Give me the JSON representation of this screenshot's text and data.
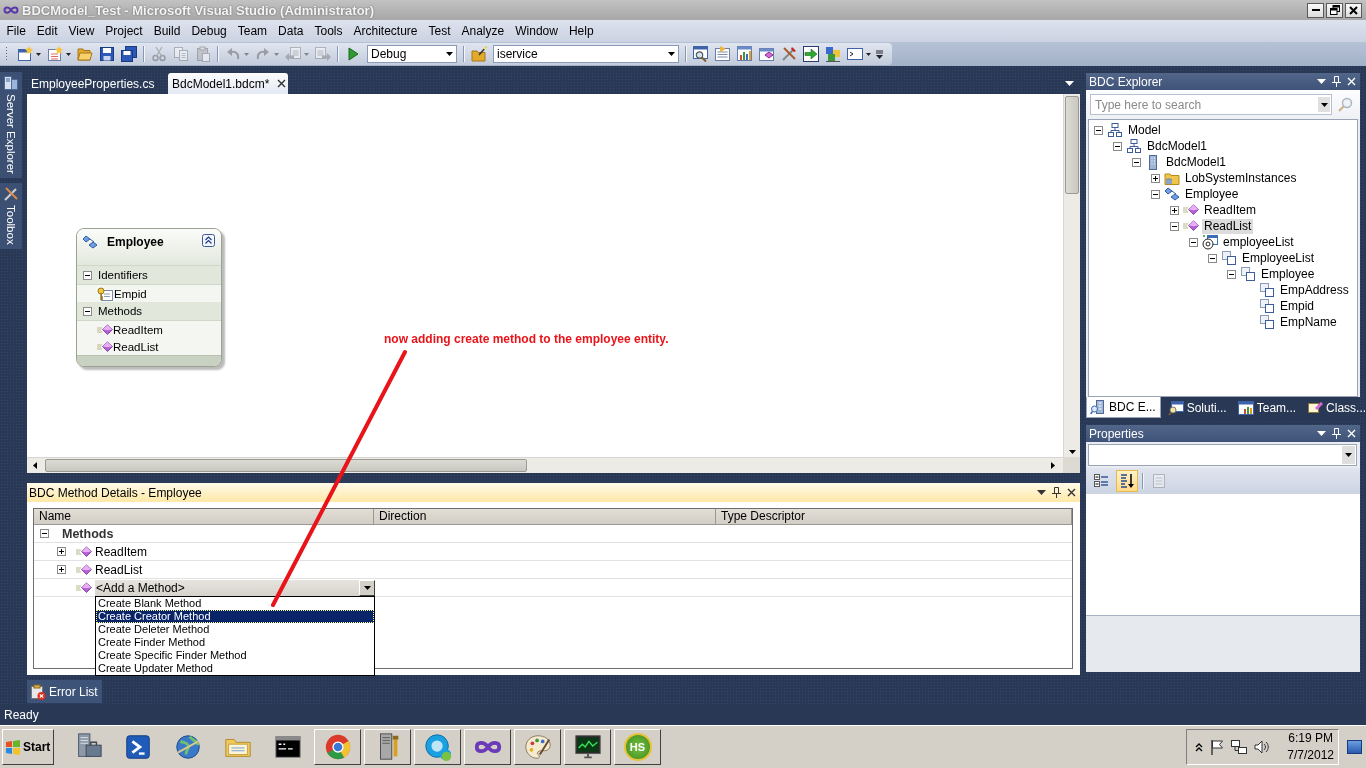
{
  "window": {
    "title": "BDCModel_Test - Microsoft Visual Studio (Administrator)"
  },
  "menu": [
    "File",
    "Edit",
    "View",
    "Project",
    "Build",
    "Debug",
    "Team",
    "Data",
    "Tools",
    "Architecture",
    "Test",
    "Analyze",
    "Window",
    "Help"
  ],
  "toolbar": [
    {
      "kind": "new-project",
      "disabled": false
    },
    {
      "kind": "add-item",
      "disabled": false
    },
    {
      "kind": "open",
      "disabled": false
    },
    {
      "kind": "save",
      "disabled": false
    },
    {
      "kind": "save-all",
      "disabled": false
    },
    {
      "kind": "separator"
    },
    {
      "kind": "cut",
      "disabled": true
    },
    {
      "kind": "copy",
      "disabled": true
    },
    {
      "kind": "paste",
      "disabled": true
    },
    {
      "kind": "separator"
    },
    {
      "kind": "undo",
      "disabled": true
    },
    {
      "kind": "redo",
      "disabled": true
    },
    {
      "kind": "back",
      "disabled": true
    },
    {
      "kind": "forward",
      "disabled": true
    },
    {
      "kind": "separator"
    },
    {
      "kind": "start",
      "disabled": false
    },
    {
      "kind": "config-combo",
      "value": "Debug"
    },
    {
      "kind": "separator"
    },
    {
      "kind": "find-in-files",
      "disabled": false
    },
    {
      "kind": "project-combo",
      "value": "iservice"
    },
    {
      "kind": "separator"
    },
    {
      "kind": "find",
      "disabled": false
    },
    {
      "kind": "properties",
      "disabled": false
    },
    {
      "kind": "chart",
      "disabled": false
    },
    {
      "kind": "extension",
      "disabled": false
    },
    {
      "kind": "tools",
      "disabled": false
    },
    {
      "kind": "import",
      "disabled": false
    },
    {
      "kind": "blocks",
      "disabled": false
    },
    {
      "kind": "console",
      "disabled": false
    }
  ],
  "side_tabs": [
    {
      "label": "Server Explorer",
      "kind": "server"
    },
    {
      "label": "Toolbox",
      "kind": "toolbox"
    }
  ],
  "document_tabs": [
    {
      "label": "EmployeeProperties.cs",
      "selected": false
    },
    {
      "label": "BdcModel1.bdcm*",
      "selected": true
    }
  ],
  "designer": {
    "entity": {
      "title": "Employee",
      "sections": [
        {
          "title": "Identifiers",
          "expanded": true,
          "items": [
            {
              "label": "Empid",
              "kind": "identifier"
            }
          ]
        },
        {
          "title": "Methods",
          "expanded": true,
          "items": [
            {
              "label": "ReadItem",
              "kind": "method"
            },
            {
              "label": "ReadList",
              "kind": "method"
            }
          ]
        }
      ]
    },
    "annotation": "now adding create method to the employee entity."
  },
  "method_details": {
    "title": "BDC Method Details - Employee",
    "columns": [
      "Name",
      "Direction",
      "Type Descriptor"
    ],
    "rows": [
      {
        "kind": "group",
        "label": "Methods",
        "expanded": true
      },
      {
        "kind": "method",
        "label": "ReadItem",
        "expanded": false
      },
      {
        "kind": "method",
        "label": "ReadList",
        "expanded": false
      },
      {
        "kind": "add",
        "label": "<Add a Method>"
      }
    ],
    "dropdown": [
      {
        "label": "Create Blank Method",
        "selected": false
      },
      {
        "label": "Create Creator Method",
        "selected": true
      },
      {
        "label": "Create Deleter Method",
        "selected": false
      },
      {
        "label": "Create Finder Method",
        "selected": false
      },
      {
        "label": "Create Specific Finder Method",
        "selected": false
      },
      {
        "label": "Create Updater Method",
        "selected": false
      }
    ]
  },
  "output_tabs": [
    "Error List"
  ],
  "status_bar": {
    "text": "Ready"
  },
  "bdc_explorer": {
    "title": "BDC Explorer",
    "search": {
      "placeholder": "Type here to search"
    },
    "tree": [
      {
        "label": "Model",
        "kind": "model",
        "expanded": true,
        "selected": false,
        "children": [
          {
            "label": "BdcModel1",
            "kind": "model",
            "expanded": true,
            "selected": false,
            "children": [
              {
                "label": "BdcModel1",
                "kind": "system",
                "expanded": true,
                "selected": false,
                "children": [
                  {
                    "label": "LobSystemInstances",
                    "kind": "folder",
                    "expanded": false,
                    "selected": false
                  },
                  {
                    "label": "Employee",
                    "kind": "entity",
                    "expanded": true,
                    "selected": false,
                    "children": [
                      {
                        "label": "ReadItem",
                        "kind": "method",
                        "expanded": false,
                        "selected": false
                      },
                      {
                        "label": "ReadList",
                        "kind": "method",
                        "expanded": true,
                        "selected": true,
                        "children": [
                          {
                            "label": "employeeList",
                            "kind": "parameter",
                            "expanded": true,
                            "selected": false,
                            "children": [
                              {
                                "label": "EmployeeList",
                                "kind": "type",
                                "expanded": true,
                                "selected": false,
                                "children": [
                                  {
                                    "label": "Employee",
                                    "kind": "type",
                                    "expanded": true,
                                    "selected": false,
                                    "children": [
                                      {
                                        "label": "EmpAddress",
                                        "kind": "type",
                                        "selected": false
                                      },
                                      {
                                        "label": "Empid",
                                        "kind": "type",
                                        "selected": false
                                      },
                                      {
                                        "label": "EmpName",
                                        "kind": "type",
                                        "selected": false
                                      }
                                    ]
                                  }
                                ]
                              }
                            ]
                          }
                        ]
                      }
                    ]
                  }
                ]
              }
            ]
          }
        ]
      }
    ],
    "tabs": [
      {
        "label": "BDC E...",
        "kind": "bdc",
        "selected": true
      },
      {
        "label": "Soluti...",
        "kind": "solution",
        "selected": false
      },
      {
        "label": "Team...",
        "kind": "team",
        "selected": false
      },
      {
        "label": "Class...",
        "kind": "class",
        "selected": false
      }
    ]
  },
  "properties": {
    "title": "Properties",
    "toolbar": [
      {
        "kind": "categorized",
        "selected": false,
        "disabled": false
      },
      {
        "kind": "alphabetical",
        "selected": true,
        "disabled": false
      },
      {
        "kind": "pages",
        "selected": false,
        "disabled": true
      }
    ]
  },
  "taskbar": {
    "start": "Start",
    "apps": [
      {
        "kind": "server",
        "running": false
      },
      {
        "kind": "shell",
        "running": false
      },
      {
        "kind": "globe",
        "running": false
      },
      {
        "kind": "folder",
        "running": false
      },
      {
        "kind": "console",
        "running": false
      },
      {
        "kind": "browser",
        "running": true
      },
      {
        "kind": "tower",
        "running": true
      },
      {
        "kind": "chat",
        "running": true
      },
      {
        "kind": "infinity",
        "running": true
      },
      {
        "kind": "palette",
        "running": true
      },
      {
        "kind": "monitor",
        "running": true
      },
      {
        "kind": "badge",
        "label": "HS",
        "running": true
      }
    ],
    "time": "6:19 PM",
    "date": "7/7/2012"
  }
}
